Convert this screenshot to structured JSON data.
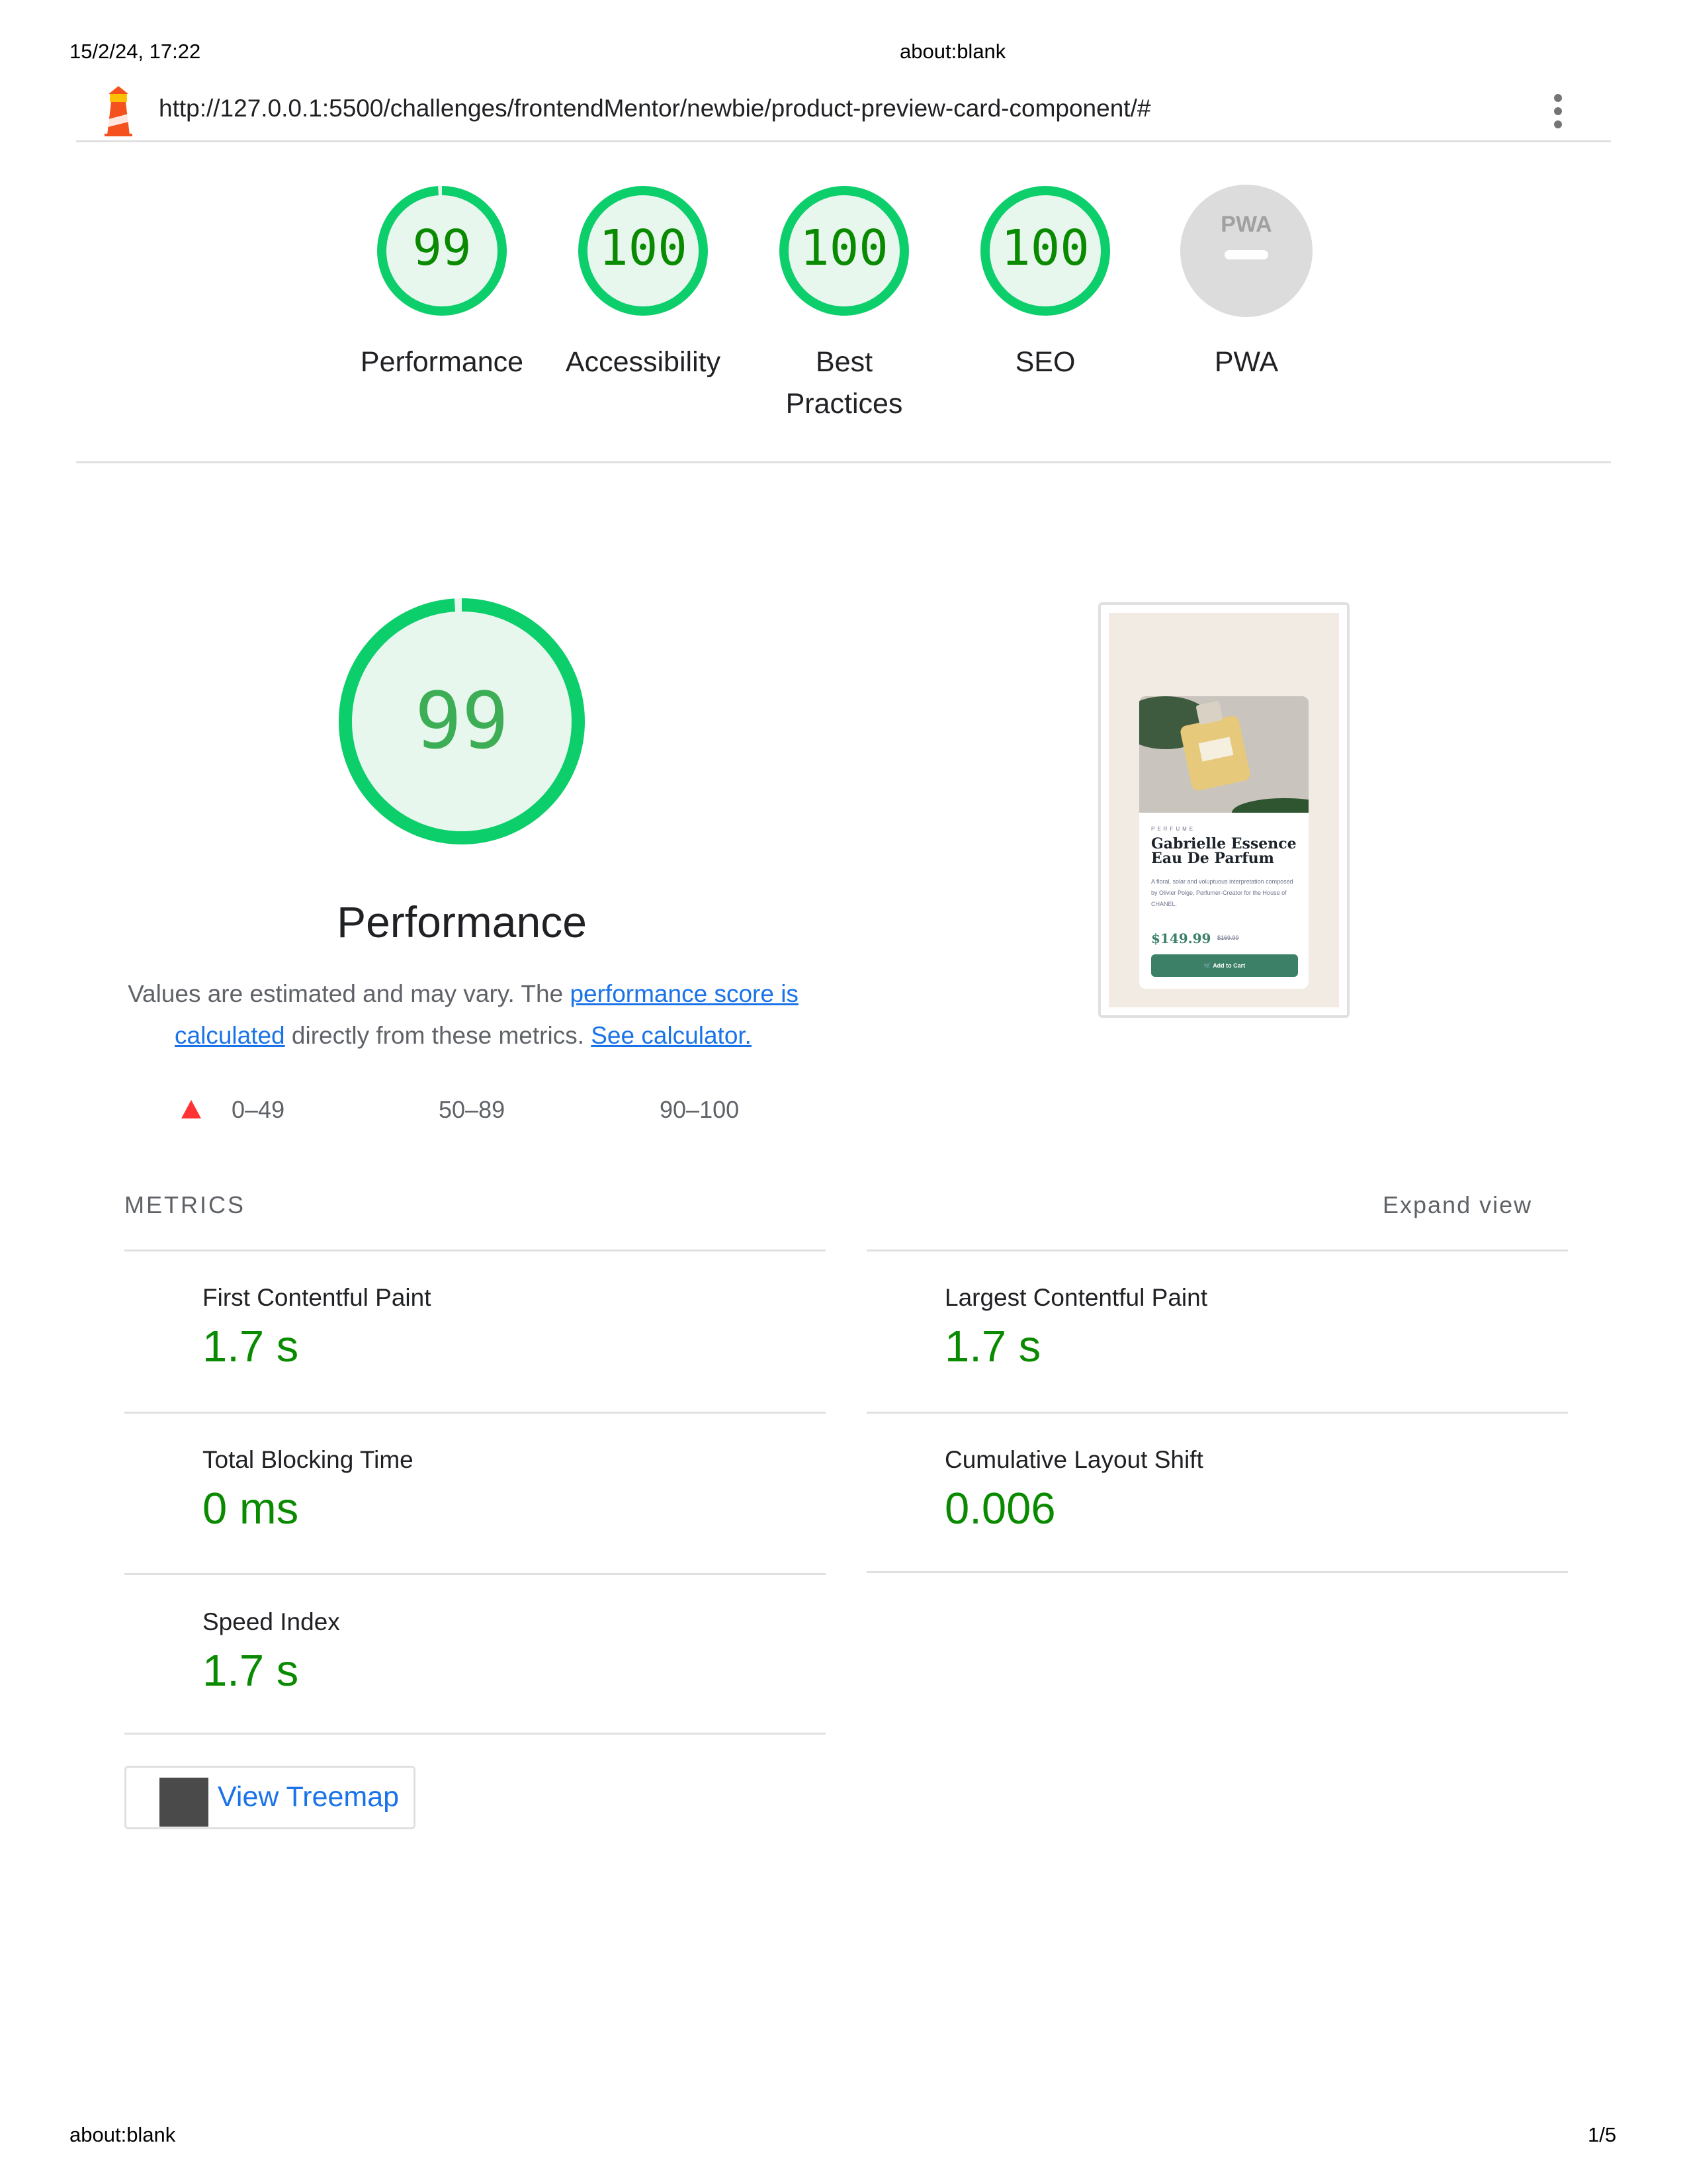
{
  "print_header": {
    "datetime": "15/2/24, 17:22",
    "title": "about:blank"
  },
  "print_footer": {
    "url": "about:blank",
    "page": "1/5"
  },
  "topbar": {
    "url": "http://127.0.0.1:5500/challenges/frontendMentor/newbie/product-preview-card-component/#",
    "logo_icon": "lighthouse-icon",
    "menu_icon": "vertical-dots-icon"
  },
  "gauges": [
    {
      "score": "99",
      "label": "Performance",
      "fraction": 0.99
    },
    {
      "score": "100",
      "label": "Accessibility",
      "fraction": 1.0
    },
    {
      "score": "100",
      "label": "Best Practices",
      "fraction": 1.0
    },
    {
      "score": "100",
      "label": "SEO",
      "fraction": 1.0
    },
    {
      "score": "",
      "label": "PWA",
      "badge": "PWA"
    }
  ],
  "performance": {
    "score": "99",
    "fraction": 0.99,
    "title": "Performance",
    "desc_prefix": "Values are estimated and may vary. The ",
    "desc_link1": "performance score is calculated",
    "desc_middle": " directly from these metrics. ",
    "desc_link2": "See calculator."
  },
  "legend": {
    "fail": "0–49",
    "average": "50–89",
    "pass": "90–100"
  },
  "screenshot": {
    "category": "PERFUME",
    "product_name": "Gabrielle Essence Eau De Parfum",
    "description": "A floral, solar and voluptuous interpretation composed by Olivier Polge, Perfumer-Creator for the House of CHANEL.",
    "price": "$149.99",
    "old_price": "$169.99",
    "button": "Add to Cart"
  },
  "metrics": {
    "header": "METRICS",
    "expand": "Expand view",
    "items": [
      {
        "name": "First Contentful Paint",
        "value": "1.7 s"
      },
      {
        "name": "Largest Contentful Paint",
        "value": "1.7 s"
      },
      {
        "name": "Total Blocking Time",
        "value": "0 ms"
      },
      {
        "name": "Cumulative Layout Shift",
        "value": "0.006"
      },
      {
        "name": "Speed Index",
        "value": "1.7 s"
      }
    ]
  },
  "treemap": {
    "label": "View Treemap"
  },
  "colors": {
    "pass": "#0cce6b",
    "pass_fill": "#e8f7ee",
    "pass_text": "#0a8a00",
    "fail": "#ff3333",
    "neutral": "#dcdcdc",
    "link": "#1a73e8",
    "product_green": "#3c8067",
    "cream": "#f2ebe3"
  }
}
